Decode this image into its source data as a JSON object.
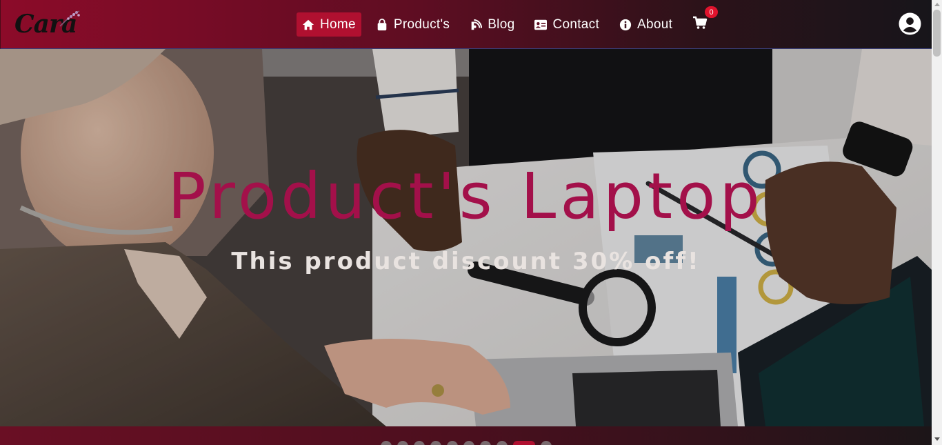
{
  "brand": {
    "logo_text": "Cara"
  },
  "nav": {
    "items": [
      {
        "label": "Home",
        "icon": "home-icon",
        "active": true
      },
      {
        "label": "Product's",
        "icon": "shopping-bag-icon",
        "active": false
      },
      {
        "label": "Blog",
        "icon": "blog-icon",
        "active": false
      },
      {
        "label": "Contact",
        "icon": "contact-card-icon",
        "active": false
      },
      {
        "label": "About",
        "icon": "info-icon",
        "active": false
      }
    ],
    "cart_count": "0"
  },
  "hero": {
    "title": "Product's Laptop",
    "subtitle": "This product discount 30% off!"
  },
  "carousel": {
    "slide_count": 10,
    "active_index": 8
  },
  "colors": {
    "accent": "#b01030",
    "title": "#a3104a",
    "badge": "#e0132d"
  }
}
